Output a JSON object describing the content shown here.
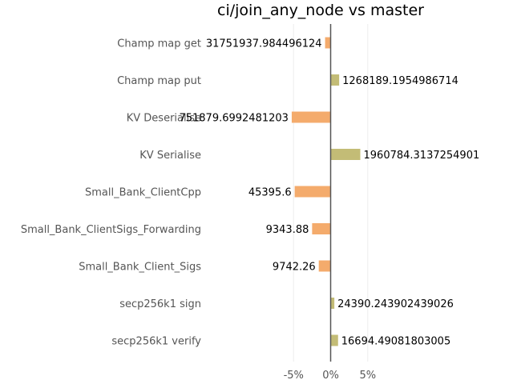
{
  "chart_data": {
    "type": "bar",
    "orientation": "horizontal",
    "title": "ci/join_any_node vs master",
    "categories": [
      "Champ map get",
      "Champ map put",
      "KV Deserialise",
      "KV Serialise",
      "Small_Bank_ClientCpp",
      "Small_Bank_ClientSigs_Forwarding",
      "Small_Bank_Client_Sigs",
      "secp256k1 sign",
      "secp256k1 verify"
    ],
    "values": [
      -1.5,
      2.3,
      -10.5,
      8.0,
      -9.7,
      -5.0,
      -3.2,
      1.0,
      2.0
    ],
    "value_labels": [
      "31751937.984496124",
      "1268189.1954986714",
      "751879.6992481203",
      "1960784.3137254901",
      "45395.6",
      "9343.88",
      "9742.26",
      "24390.243902439026",
      "16694.49081803005"
    ],
    "xlim": [
      -20,
      20
    ],
    "xticks": [
      -10,
      0,
      10
    ],
    "xtick_labels": [
      "-5%",
      "0%",
      "5%"
    ],
    "grid": true,
    "legend": "none",
    "colors": {
      "negative": "#f4ab6c",
      "positive": "#c3bc76",
      "zero_line": "#555555",
      "grid": "#eeeeee"
    }
  }
}
